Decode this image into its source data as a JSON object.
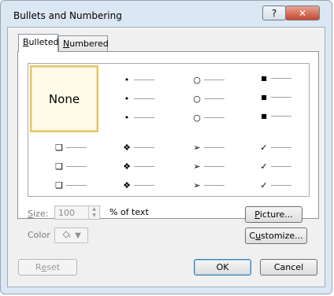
{
  "dialog": {
    "title": "Bullets and Numbering",
    "help_glyph": "?",
    "close_glyph": "✕"
  },
  "tabs": [
    {
      "label_hot": "B",
      "label_rest": "ulleted",
      "active": true
    },
    {
      "label_hot": "N",
      "label_rest": "umbered",
      "active": false
    }
  ],
  "gallery": {
    "none_label": "None",
    "styles": [
      {
        "name": "dot",
        "glyph": "•"
      },
      {
        "name": "circle",
        "glyph": "○"
      },
      {
        "name": "square",
        "glyph": "■"
      },
      {
        "name": "hollow-square",
        "glyph": "❑"
      },
      {
        "name": "diamond-cluster",
        "glyph": "❖"
      },
      {
        "name": "arrowhead",
        "glyph": "➢"
      },
      {
        "name": "checkmark",
        "glyph": "✓"
      }
    ]
  },
  "size": {
    "label_hot": "S",
    "label_rest": "ize:",
    "value": "100",
    "unit": "% of text"
  },
  "color": {
    "label": "Color"
  },
  "buttons": {
    "picture_hot": "P",
    "picture_rest": "icture...",
    "customize_pre": "C",
    "customize_hot": "u",
    "customize_rest": "stomize...",
    "reset_pre": "R",
    "reset_hot": "e",
    "reset_rest": "set",
    "ok": "OK",
    "cancel": "Cancel"
  }
}
